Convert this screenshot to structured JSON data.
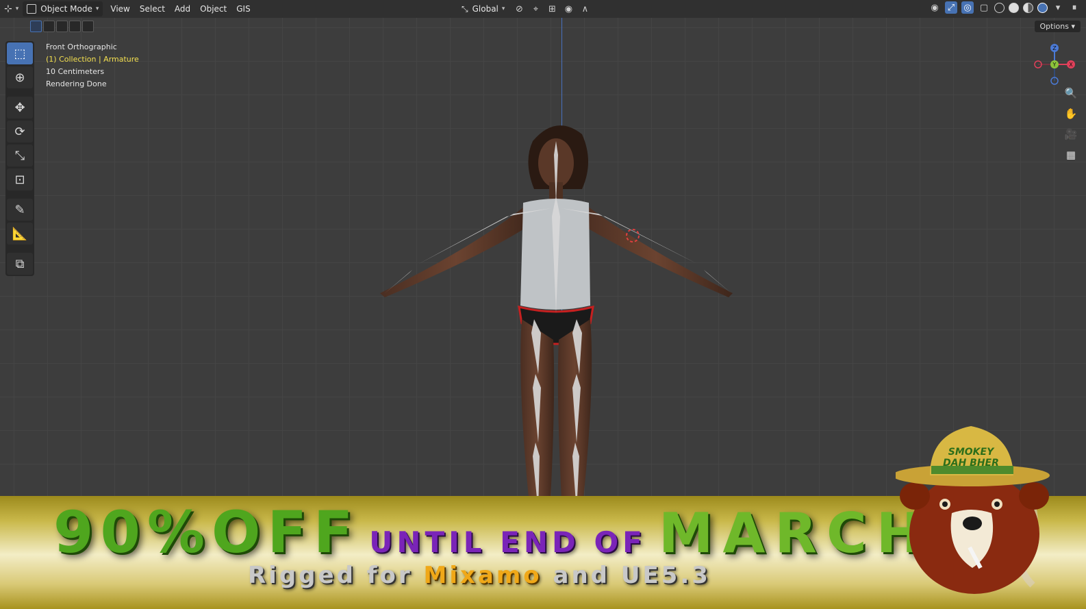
{
  "header": {
    "editor_icon": "editor-type-icon",
    "mode_label": "Object Mode",
    "menus": [
      "View",
      "Select",
      "Add",
      "Object",
      "GIS"
    ],
    "transform_orientation": "Global",
    "options_label": "Options"
  },
  "viewport": {
    "view_name": "Front Orthographic",
    "collection_label": "(1) Collection | Armature",
    "grid_scale": "10 Centimeters",
    "render_status": "Rendering Done",
    "gizmo_axes": [
      "Z",
      "Y",
      "X"
    ]
  },
  "toolbar": {
    "tools": [
      "select-box",
      "cursor",
      "move",
      "rotate",
      "scale",
      "transform",
      "annotate",
      "measure",
      "add-cube"
    ],
    "active_tool": "select-box"
  },
  "banner": {
    "discount": "90%OFF",
    "until": "UNTIL END OF",
    "month": "MARCH",
    "sub_prefix": "Rigged for",
    "sub_highlight": "Mixamo",
    "sub_suffix": "and UE5.3",
    "mascot_hat_line1": "SMOKEY",
    "mascot_hat_line2": "DAH BHER"
  },
  "colors": {
    "accent": "#4772b3",
    "banner_green": "#4fa61e",
    "banner_purple": "#7a24b8",
    "banner_orange": "#f0a818"
  }
}
